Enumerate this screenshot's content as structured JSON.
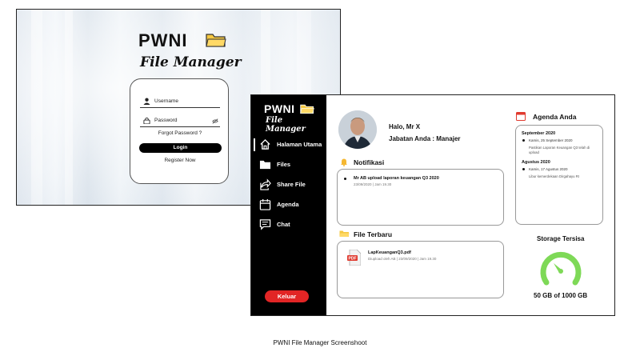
{
  "login": {
    "brand_title": "PWNI",
    "brand_subtitle": "File Manager",
    "username_placeholder": "Username",
    "password_placeholder": "Password",
    "forgot_link": "Forgot Password ?",
    "login_button": "Login",
    "register_link": "Register Now"
  },
  "dashboard": {
    "brand_title": "PWNI",
    "brand_subtitle": "File Manager",
    "nav": [
      {
        "label": "Halaman Utama",
        "icon": "home-icon",
        "active": true
      },
      {
        "label": "Files",
        "icon": "folder-icon"
      },
      {
        "label": "Share File",
        "icon": "share-icon"
      },
      {
        "label": "Agenda",
        "icon": "calendar-icon"
      },
      {
        "label": "Chat",
        "icon": "chat-icon"
      }
    ],
    "logout_button": "Keluar",
    "greeting": "Halo, Mr X",
    "role": "Jabatan Anda : Manajer",
    "notifications": {
      "title": "Notifikasi",
      "items": [
        {
          "text": "Mr AB upload laporan keuangan Q3 2020",
          "meta": "23/09/2020 | Jam 19.30"
        }
      ]
    },
    "recent_files": {
      "title": "File Terbaru",
      "items": [
        {
          "name": "LapKeuanganQ3.pdf",
          "meta": "Diupload oleh AB | 23/09/2020 | Jam 19.30",
          "icon_label": "PDF"
        }
      ]
    },
    "agenda": {
      "title": "Agenda Anda",
      "groups": [
        {
          "month": "September 2020",
          "date": "Kamis, 25 September 2020",
          "desc": "Pastikan Laporan Keuangan Q3 telah di upload"
        },
        {
          "month": "Agustus 2020",
          "date": "Kamis, 17 Agustus 2020",
          "desc": "Libur kemerdekaan Dirgahayu RI"
        }
      ]
    },
    "storage": {
      "title": "Storage Tersisa",
      "value_text": "50 GB of 1000 GB",
      "gauge_color": "#7ed957"
    }
  },
  "caption": "PWNI File Manager Screenshoot",
  "colors": {
    "logout": "#e22525",
    "folder": "#f5c842",
    "sidebar": "#000000"
  }
}
